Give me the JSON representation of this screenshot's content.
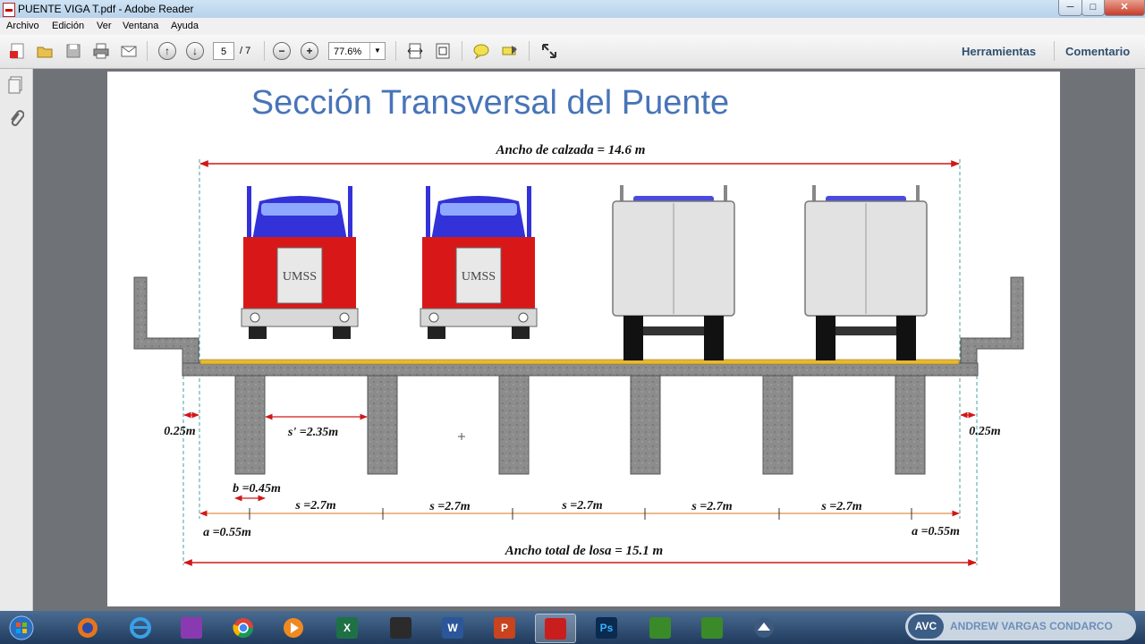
{
  "window": {
    "title": "PUENTE VIGA T.pdf - Adobe Reader",
    "controls": {
      "minimize": "─",
      "maximize": "□",
      "close": "✕"
    }
  },
  "menubar": [
    "Archivo",
    "Edición",
    "Ver",
    "Ventana",
    "Ayuda"
  ],
  "toolbar": {
    "current_page": "5",
    "total_pages": "/ 7",
    "zoom": "77.6%",
    "zoom_out": "−",
    "zoom_in": "+",
    "prev_page": "↑",
    "next_page": "↓",
    "tools_label": "Herramientas",
    "comment_label": "Comentario"
  },
  "document": {
    "title": "Sección Transversal del Puente",
    "roadway_width": "Ancho de calzada = 14.6 m",
    "total_width": "Ancho total de losa = 15.1 m",
    "clear_spacing": "s' =2.35m",
    "beam_width": "b =0.45m",
    "spacings": [
      "s =2.7m",
      "s =2.7m",
      "s =2.7m",
      "s =2.7m",
      "s =2.7m"
    ],
    "left_edge": "0.25m",
    "right_edge": "0.25m",
    "left_overhang": "a =0.55m",
    "right_overhang": "a =0.55m",
    "truck_logo": "UMSS",
    "num_beams": 6,
    "num_trucks_front": 2,
    "num_trucks_rear": 2,
    "colors": {
      "title_blue": "#4874b8",
      "dimension_red": "#d01818",
      "concrete": "#8c8c8c",
      "pavement": "#e8b830",
      "truck_blue": "#3232d8",
      "truck_red": "#d81818"
    }
  },
  "taskbar": {
    "apps": [
      "start-orb",
      "firefox",
      "internet-explorer",
      "winrar",
      "chrome",
      "media-player",
      "excel",
      "autocad",
      "word",
      "powerpoint",
      "acrobat",
      "photoshop",
      "camtasia",
      "camtasia",
      "visual-studio"
    ],
    "excel_letter": "X",
    "word_letter": "W",
    "powerpoint_letter": "P",
    "photoshop_letters": "Ps"
  },
  "watermark": {
    "logo": "AVC",
    "name": "ANDREW VARGAS CONDARCO"
  }
}
